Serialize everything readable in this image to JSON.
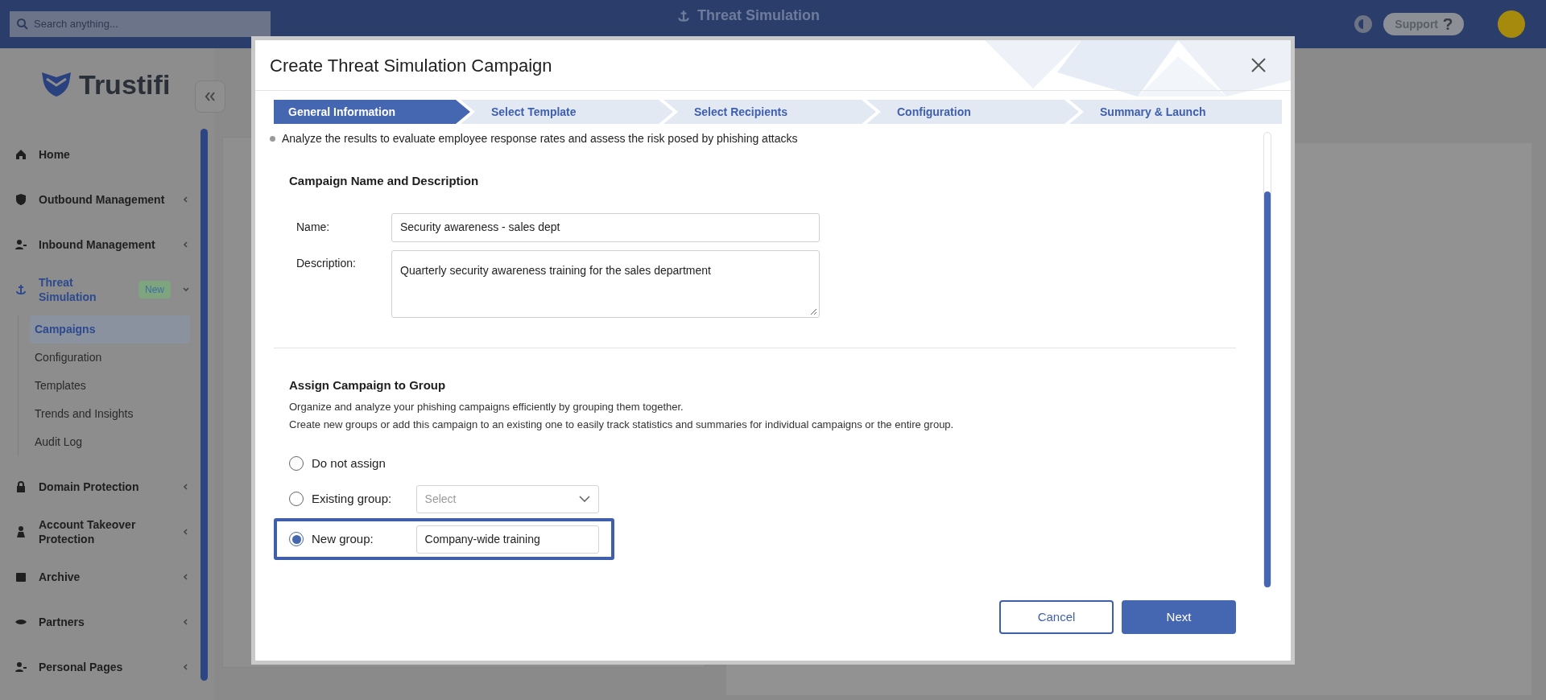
{
  "topbar": {
    "search_placeholder": "Search anything...",
    "title": "Threat Simulation",
    "support": "Support"
  },
  "sidebar": {
    "logo": "Trustifi",
    "items": [
      {
        "label": "Home",
        "kind": "link"
      },
      {
        "label": "Outbound Management",
        "kind": "group",
        "expanded": false
      },
      {
        "label": "Inbound Management",
        "kind": "group",
        "expanded": false
      },
      {
        "label": "Threat Simulation",
        "kind": "group",
        "expanded": true,
        "badge": "New",
        "children": [
          {
            "label": "Campaigns",
            "selected": true
          },
          {
            "label": "Configuration",
            "selected": false
          },
          {
            "label": "Templates",
            "selected": false
          },
          {
            "label": "Trends and Insights",
            "selected": false
          },
          {
            "label": "Audit Log",
            "selected": false
          }
        ]
      },
      {
        "label": "Domain Protection",
        "kind": "group",
        "expanded": false
      },
      {
        "label": "Account Takeover Protection",
        "kind": "group",
        "expanded": false
      },
      {
        "label": "Archive",
        "kind": "group",
        "expanded": false
      },
      {
        "label": "Partners",
        "kind": "group",
        "expanded": false
      },
      {
        "label": "Personal Pages",
        "kind": "group",
        "expanded": false
      }
    ]
  },
  "modal": {
    "title": "Create Threat Simulation Campaign",
    "steps": [
      {
        "label": "General Information",
        "selected": true
      },
      {
        "label": "Select Template",
        "selected": false
      },
      {
        "label": "Select Recipients",
        "selected": false
      },
      {
        "label": "Configuration",
        "selected": false
      },
      {
        "label": "Summary & Launch",
        "selected": false
      }
    ],
    "bullet": "Analyze the results to evaluate employee response rates and assess the risk posed by phishing attacks",
    "name_section": {
      "heading": "Campaign Name and Description",
      "name_label": "Name:",
      "name_value": "Security awareness - sales dept",
      "description_label": "Description:",
      "description_value": "Quarterly security awareness training for the sales department"
    },
    "group_section": {
      "heading": "Assign Campaign to Group",
      "description": [
        "Organize and analyze your phishing campaigns efficiently by grouping them together.",
        "Create new groups or add this campaign to an existing one to easily track statistics and summaries for individual campaigns or the entire group."
      ],
      "options": [
        {
          "label": "Do not assign",
          "kind": "none",
          "selected": false
        },
        {
          "label": "Existing group:",
          "kind": "select",
          "placeholder": "Select",
          "selected": false
        },
        {
          "label": "New group:",
          "kind": "input",
          "value": "Company-wide training",
          "selected": true
        }
      ]
    },
    "buttons": [
      {
        "label": "Cancel",
        "kind": "secondary"
      },
      {
        "label": "Next",
        "kind": "primary"
      }
    ]
  }
}
